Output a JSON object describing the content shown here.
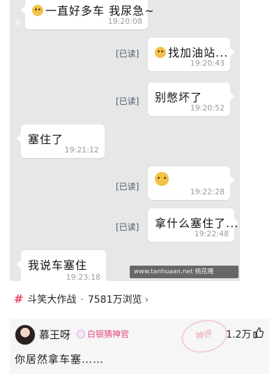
{
  "chat": {
    "messages": [
      {
        "side": "left",
        "text": "一直好多车 我尿急~",
        "time": "19:20:08",
        "emoji": true
      },
      {
        "side": "right",
        "text": "找加油站...",
        "time": "19:20:43",
        "read": "[已读]",
        "emoji": true
      },
      {
        "side": "right",
        "text": "别憋坏了",
        "time": "19:20:52",
        "read": "[已读]"
      },
      {
        "side": "left",
        "text": "塞住了",
        "time": "19:21:12"
      },
      {
        "side": "right",
        "text": "",
        "time": "19:22:28",
        "read": "[已读]",
        "emoji": true
      },
      {
        "side": "right",
        "text": "拿什么塞住了...",
        "time": "19:22:48",
        "read": "[已读]"
      },
      {
        "side": "left",
        "text": "我说车塞住",
        "time": "19:23:18"
      }
    ],
    "watermark_bottom": "www.tanhuaan.net 桃花庵"
  },
  "topic": {
    "title": "斗笑大作战",
    "views": "7581万浏览",
    "separator": "·"
  },
  "comment": {
    "username": "慕王呀",
    "badge": "白银猜神官",
    "stamp": "神评",
    "likes": "1.2万",
    "text": "你居然拿车塞……",
    "accent": "#e8435b"
  }
}
